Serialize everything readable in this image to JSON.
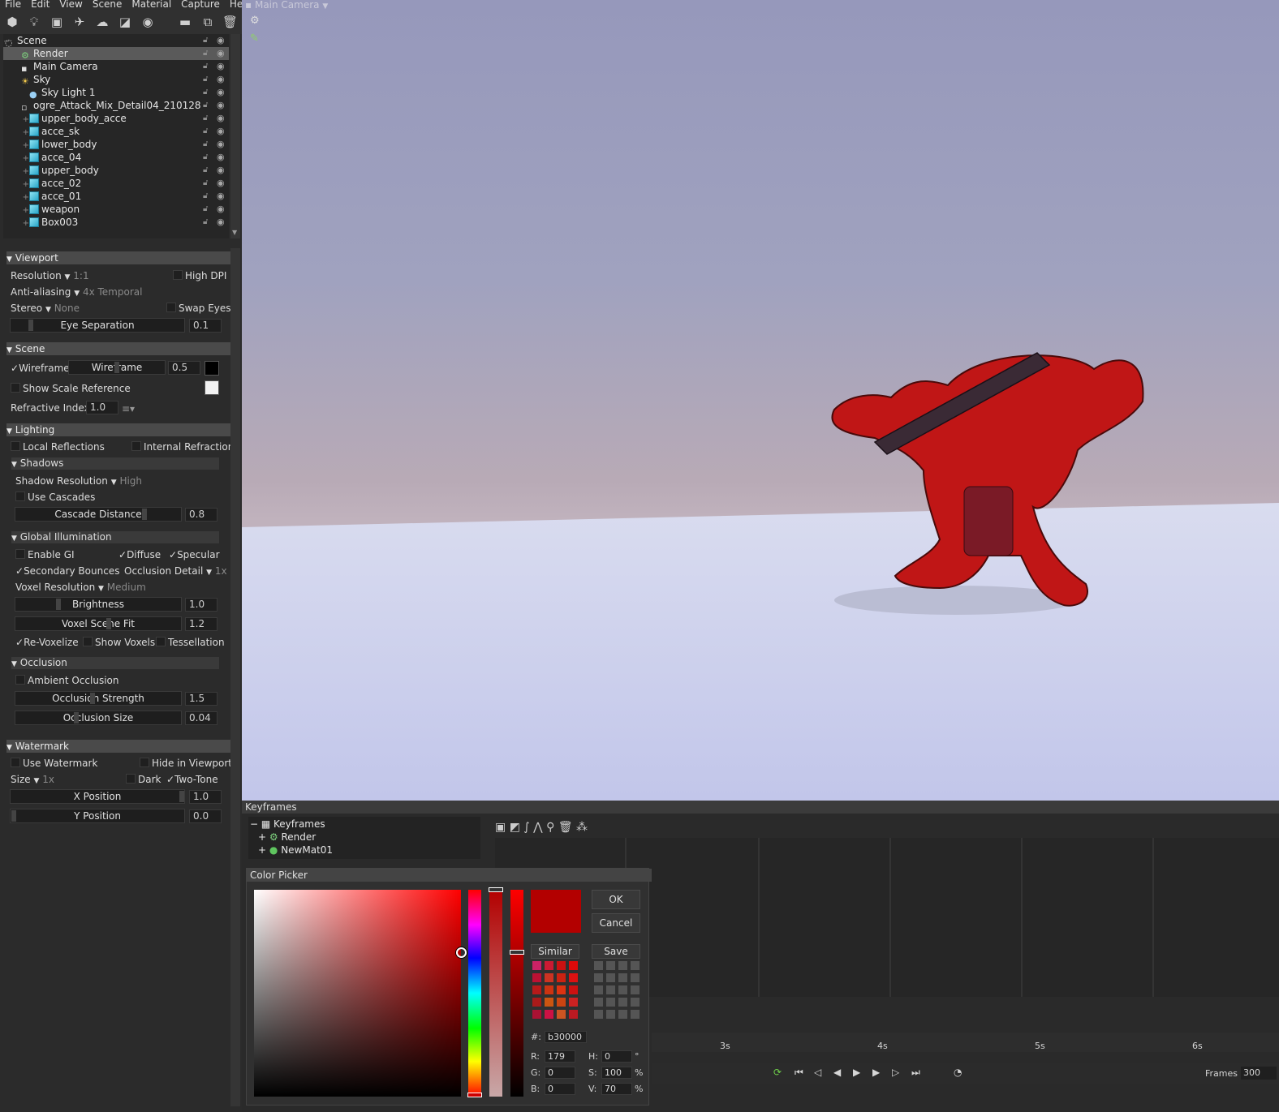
{
  "menu": [
    "File",
    "Edit",
    "View",
    "Scene",
    "Material",
    "Capture",
    "Help"
  ],
  "viewport": {
    "camera_label": "Main Camera"
  },
  "tree": [
    {
      "label": "Scene",
      "indent": 0,
      "icon": "scene-icon",
      "selected": false
    },
    {
      "label": "Render",
      "indent": 2,
      "icon": "gear-icon",
      "selected": true
    },
    {
      "label": "Main Camera",
      "indent": 2,
      "icon": "camera-icon",
      "selected": false
    },
    {
      "label": "Sky",
      "indent": 2,
      "icon": "sky-icon",
      "selected": false
    },
    {
      "label": "Sky Light 1",
      "indent": 3,
      "icon": "light-bulb-icon",
      "selected": false
    },
    {
      "label": "ogre_Attack_Mix_Detail04_210128",
      "indent": 2,
      "icon": "model-icon",
      "selected": false
    },
    {
      "label": "upper_body_acce",
      "indent": 3,
      "icon": "mesh-icon",
      "selected": false
    },
    {
      "label": "acce_sk",
      "indent": 3,
      "icon": "mesh-icon",
      "selected": false
    },
    {
      "label": "lower_body",
      "indent": 3,
      "icon": "mesh-icon",
      "selected": false
    },
    {
      "label": "acce_04",
      "indent": 3,
      "icon": "mesh-icon",
      "selected": false
    },
    {
      "label": "upper_body",
      "indent": 3,
      "icon": "mesh-icon",
      "selected": false
    },
    {
      "label": "acce_02",
      "indent": 3,
      "icon": "mesh-icon",
      "selected": false
    },
    {
      "label": "acce_01",
      "indent": 3,
      "icon": "mesh-icon",
      "selected": false
    },
    {
      "label": "weapon",
      "indent": 3,
      "icon": "mesh-icon",
      "selected": false
    },
    {
      "label": "Box003",
      "indent": 3,
      "icon": "mesh-icon",
      "selected": false
    }
  ],
  "props": {
    "viewport": {
      "title": "Viewport",
      "resolution_label": "Resolution",
      "resolution_value": "1:1",
      "high_dpi": "High DPI",
      "aa_label": "Anti-aliasing",
      "aa_value": "4x Temporal",
      "stereo_label": "Stereo",
      "stereo_value": "None",
      "swap_eyes": "Swap Eyes",
      "eye_sep_label": "Eye Separation",
      "eye_sep_value": "0.1"
    },
    "scene": {
      "title": "Scene",
      "wireframe": "Wireframe",
      "wireframe_slider": "Wireframe",
      "wireframe_value": "0.5",
      "show_scale": "Show Scale Reference",
      "refr_label": "Refractive Index:",
      "refr_value": "1.0"
    },
    "lighting": {
      "title": "Lighting",
      "local_refl": "Local Reflections",
      "internal_refr": "Internal Refraction"
    },
    "shadows": {
      "title": "Shadows",
      "res_label": "Shadow Resolution",
      "res_value": "High",
      "use_cascades": "Use Cascades",
      "cascade_label": "Cascade Distance",
      "cascade_value": "0.8"
    },
    "gi": {
      "title": "Global Illumination",
      "enable": "Enable GI",
      "diffuse": "Diffuse",
      "specular": "Specular",
      "secondary": "Secondary Bounces",
      "occl_detail": "Occlusion Detail",
      "occl_detail_value": "1x",
      "voxel_res": "Voxel Resolution",
      "voxel_res_value": "Medium",
      "brightness": "Brightness",
      "brightness_value": "1.0",
      "voxel_fit": "Voxel Scene Fit",
      "voxel_fit_value": "1.2",
      "revox": "Re-Voxelize",
      "show_voxels": "Show Voxels",
      "tess": "Tessellation"
    },
    "occlusion": {
      "title": "Occlusion",
      "ambient": "Ambient Occlusion",
      "strength": "Occlusion Strength",
      "strength_value": "1.5",
      "size": "Occlusion Size",
      "size_value": "0.04"
    },
    "watermark": {
      "title": "Watermark",
      "use": "Use Watermark",
      "hide": "Hide in Viewport",
      "size_label": "Size",
      "size_value": "1x",
      "dark": "Dark",
      "two_tone": "Two-Tone",
      "xpos": "X Position",
      "xpos_value": "1.0",
      "ypos": "Y Position",
      "ypos_value": "0.0"
    }
  },
  "keyframes": {
    "title": "Keyframes",
    "tree": [
      "Keyframes",
      "Render",
      "NewMat01"
    ],
    "ruler": [
      "3s",
      "4s",
      "5s",
      "6s"
    ],
    "frames_label": "Frames",
    "frames_value": "300"
  },
  "color_picker": {
    "title": "Color Picker",
    "ok": "OK",
    "cancel": "Cancel",
    "similar": "Similar",
    "save": "Save",
    "hex_label": "#:",
    "hex": "b30000",
    "r_label": "R:",
    "r": "179",
    "g_label": "G:",
    "g": "0",
    "b_label": "B:",
    "b": "0",
    "h_label": "H:",
    "h": "0",
    "h_unit": "°",
    "s_label": "S:",
    "s": "100",
    "s_unit": "%",
    "v_label": "V:",
    "v": "70",
    "v_unit": "%",
    "current_color": "#b30000",
    "similar_colors": [
      "#cc2266",
      "#cc1a33",
      "#cc1111",
      "#dd0a0a",
      "#bb1133",
      "#cc3322",
      "#cc2211",
      "#dd1111",
      "#b81a1a",
      "#cc3311",
      "#dd3311",
      "#cc1111",
      "#aa1a1a",
      "#cc5511",
      "#cc4411",
      "#cc2222",
      "#aa1133",
      "#cc1144",
      "#cc5522",
      "#bb1a22"
    ]
  }
}
